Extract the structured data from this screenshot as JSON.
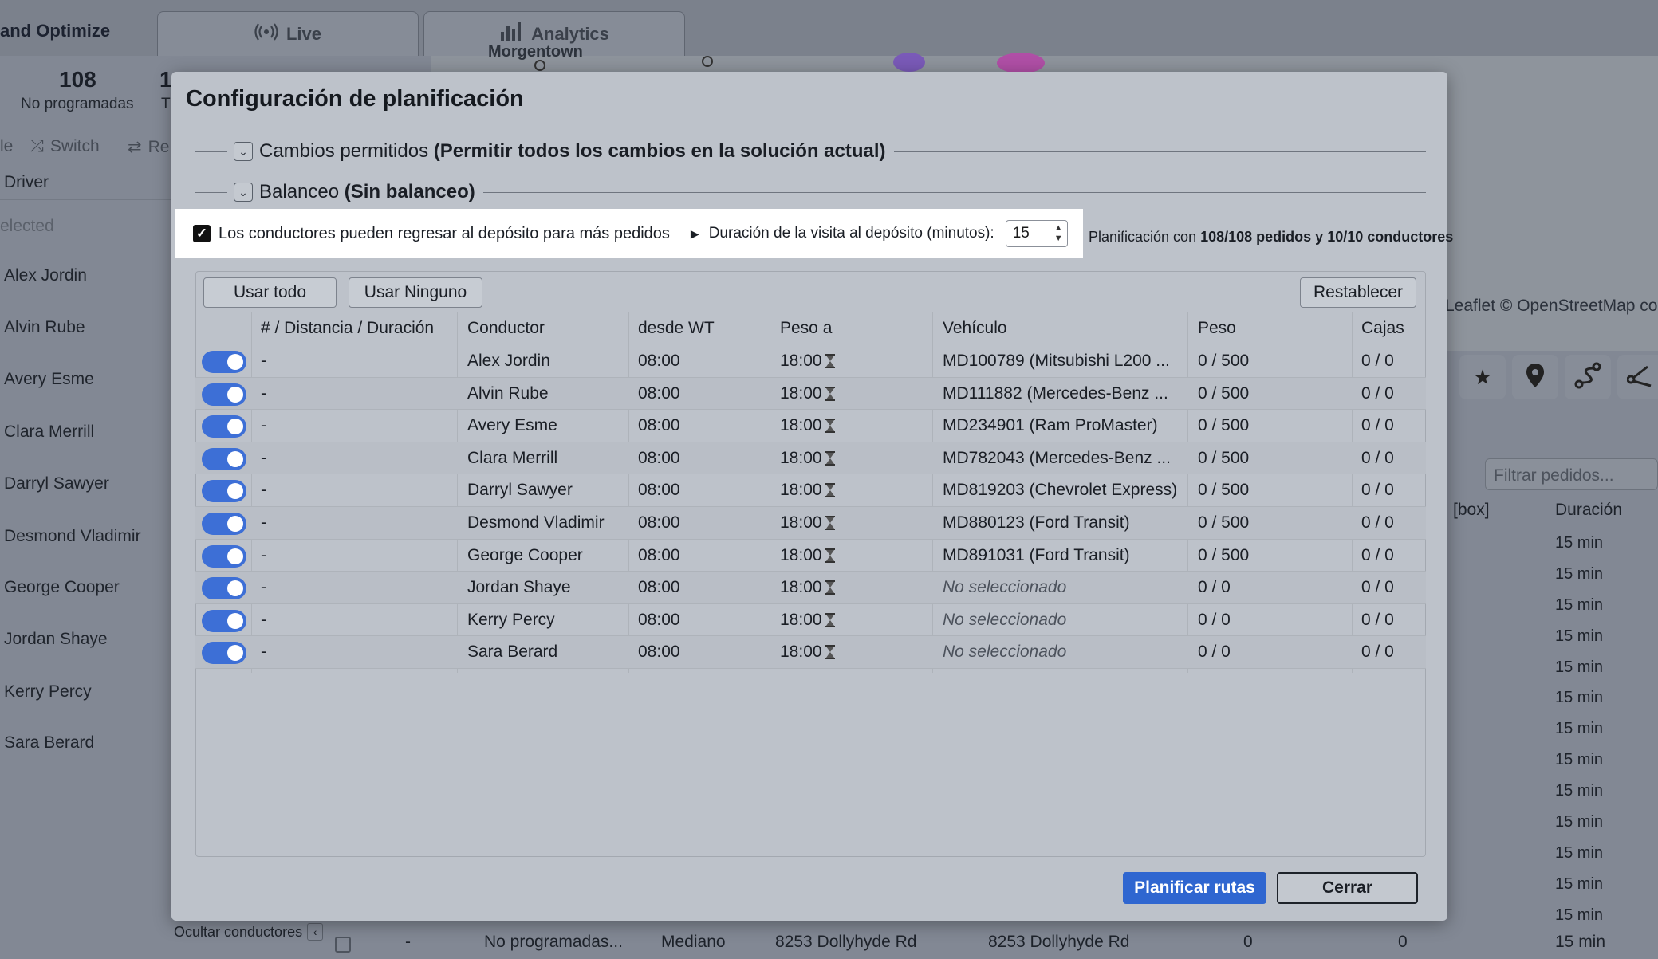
{
  "background": {
    "app_title": "and Optimize",
    "tabs": [
      {
        "label": "Live",
        "icon": "broadcast-icon"
      },
      {
        "label": "Analytics",
        "icon": "bar-chart-icon"
      }
    ],
    "map_label": "Morgentown",
    "map_credit": "Leaflet © OpenStreetMap contributors",
    "stats": [
      {
        "value": "108",
        "label": "No programadas"
      },
      {
        "value": "1",
        "label": "T"
      }
    ],
    "toolbar": {
      "item1": "le",
      "switch": "Switch",
      "item3": "Re"
    },
    "driver_list": {
      "header": "Driver",
      "selected": "elected",
      "items": [
        "Alex Jordin",
        "Alvin Rube",
        "Avery Esme",
        "Clara Merrill",
        "Darryl Sawyer",
        "Desmond Vladimir",
        "George Cooper",
        "Jordan Shaye",
        "Kerry Percy",
        "Sara Berard"
      ]
    },
    "filter_placeholder": "Filtrar pedidos...",
    "orders_columns": {
      "box": "[box]",
      "duration": "Duración"
    },
    "durations": [
      "15 min",
      "15 min",
      "15 min",
      "15 min",
      "15 min",
      "15 min",
      "15 min",
      "15 min",
      "15 min",
      "15 min",
      "15 min",
      "15 min",
      "15 min",
      "15 min"
    ],
    "hide_drivers": "Ocultar conductores",
    "bottom_row": {
      "dash": "-",
      "status": "No programadas...",
      "size": "Mediano",
      "addr1": "8253 Dollyhyde Rd",
      "addr2": "8253 Dollyhyde Rd",
      "n1": "0",
      "n2": "0",
      "dur": "15 min"
    }
  },
  "modal": {
    "title": "Configuración de planificación",
    "section_changes": {
      "label": "Cambios permitidos",
      "value": "(Permitir todos los cambios en la solución actual)"
    },
    "section_balance": {
      "label": "Balanceo",
      "value": "(Sin balanceo)"
    },
    "return_depot_label": "Los conductores pueden regresar al depósito para más pedidos",
    "return_depot_checked": true,
    "depot_duration_label": "Duración de la visita al depósito (minutos):",
    "depot_duration_value": "15",
    "summary_prefix": "Planificación con",
    "summary_bold": "108/108 pedidos y 10/10 conductores",
    "buttons": {
      "use_all": "Usar todo",
      "use_none": "Usar Ninguno",
      "reset": "Restablecer",
      "plan": "Planificar rutas",
      "close": "Cerrar"
    },
    "columns": [
      "# / Distancia / Duración",
      "Conductor",
      "desde WT",
      "Peso a",
      "Vehículo",
      "Peso",
      "Cajas"
    ],
    "rows": [
      {
        "enabled": true,
        "dist": "-",
        "driver": "Alex Jordin",
        "from": "08:00",
        "to": "18:00",
        "vehicle": "MD100789 (Mitsubishi L200 ...",
        "vehicle_selected": true,
        "weight": "0 / 500",
        "boxes": "0 / 0"
      },
      {
        "enabled": true,
        "dist": "-",
        "driver": "Alvin Rube",
        "from": "08:00",
        "to": "18:00",
        "vehicle": "MD111882 (Mercedes-Benz ...",
        "vehicle_selected": true,
        "weight": "0 / 500",
        "boxes": "0 / 0"
      },
      {
        "enabled": true,
        "dist": "-",
        "driver": "Avery Esme",
        "from": "08:00",
        "to": "18:00",
        "vehicle": "MD234901 (Ram ProMaster)",
        "vehicle_selected": true,
        "weight": "0 / 500",
        "boxes": "0 / 0"
      },
      {
        "enabled": true,
        "dist": "-",
        "driver": "Clara Merrill",
        "from": "08:00",
        "to": "18:00",
        "vehicle": "MD782043 (Mercedes-Benz ...",
        "vehicle_selected": true,
        "weight": "0 / 500",
        "boxes": "0 / 0"
      },
      {
        "enabled": true,
        "dist": "-",
        "driver": "Darryl Sawyer",
        "from": "08:00",
        "to": "18:00",
        "vehicle": "MD819203 (Chevrolet Express)",
        "vehicle_selected": true,
        "weight": "0 / 500",
        "boxes": "0 / 0"
      },
      {
        "enabled": true,
        "dist": "-",
        "driver": "Desmond Vladimir",
        "from": "08:00",
        "to": "18:00",
        "vehicle": "MD880123 (Ford Transit)",
        "vehicle_selected": true,
        "weight": "0 / 500",
        "boxes": "0 / 0"
      },
      {
        "enabled": true,
        "dist": "-",
        "driver": "George Cooper",
        "from": "08:00",
        "to": "18:00",
        "vehicle": "MD891031 (Ford Transit)",
        "vehicle_selected": true,
        "weight": "0 / 500",
        "boxes": "0 / 0"
      },
      {
        "enabled": true,
        "dist": "-",
        "driver": "Jordan Shaye",
        "from": "08:00",
        "to": "18:00",
        "vehicle": "No seleccionado",
        "vehicle_selected": false,
        "weight": "0 / 0",
        "boxes": "0 / 0"
      },
      {
        "enabled": true,
        "dist": "-",
        "driver": "Kerry Percy",
        "from": "08:00",
        "to": "18:00",
        "vehicle": "No seleccionado",
        "vehicle_selected": false,
        "weight": "0 / 0",
        "boxes": "0 / 0"
      },
      {
        "enabled": true,
        "dist": "-",
        "driver": "Sara Berard",
        "from": "08:00",
        "to": "18:00",
        "vehicle": "No seleccionado",
        "vehicle_selected": false,
        "weight": "0 / 0",
        "boxes": "0 / 0"
      }
    ]
  },
  "colors": {
    "accent": "#2f66d0",
    "toggle_on": "#3d6fd6",
    "overlay": "#828894",
    "modal_bg": "#bdc2ca"
  }
}
